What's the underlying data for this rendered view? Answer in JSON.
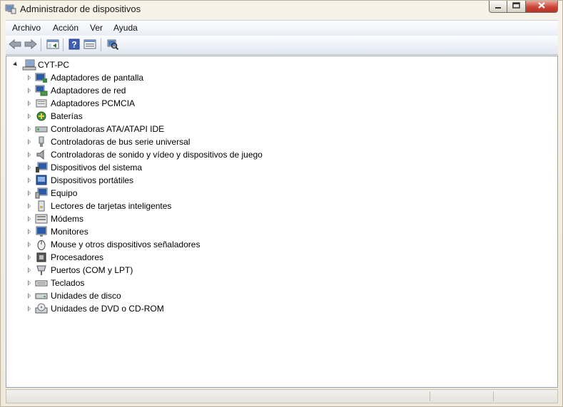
{
  "window": {
    "title": "Administrador de dispositivos",
    "icon": "device-manager-icon",
    "controls": [
      "minimize-icon",
      "maximize-icon",
      "close-icon"
    ]
  },
  "menu": {
    "items": [
      "Archivo",
      "Acción",
      "Ver",
      "Ayuda"
    ]
  },
  "toolbar": {
    "icons": [
      "back-arrow-icon",
      "forward-arrow-icon",
      "show-hide-tree-icon",
      "help-icon",
      "properties-icon",
      "scan-hardware-icon"
    ]
  },
  "tree": {
    "root": {
      "label": "CYT-PC",
      "expanded": true,
      "icon": "computer-icon"
    },
    "items": [
      {
        "label": "Adaptadores de pantalla",
        "icon": "display-adapter-icon"
      },
      {
        "label": "Adaptadores de red",
        "icon": "network-adapter-icon"
      },
      {
        "label": "Adaptadores PCMCIA",
        "icon": "pcmcia-icon"
      },
      {
        "label": "Baterías",
        "icon": "battery-icon"
      },
      {
        "label": "Controladoras ATA/ATAPI IDE",
        "icon": "ide-controller-icon"
      },
      {
        "label": "Controladoras de bus serie universal",
        "icon": "usb-icon"
      },
      {
        "label": "Controladoras de sonido y vídeo y dispositivos de juego",
        "icon": "speaker-icon"
      },
      {
        "label": "Dispositivos del sistema",
        "icon": "system-device-icon"
      },
      {
        "label": "Dispositivos portátiles",
        "icon": "portable-device-icon"
      },
      {
        "label": "Equipo",
        "icon": "computer-small-icon"
      },
      {
        "label": "Lectores de tarjetas inteligentes",
        "icon": "smart-card-icon"
      },
      {
        "label": "Módems",
        "icon": "modem-icon"
      },
      {
        "label": "Monitores",
        "icon": "monitor-icon"
      },
      {
        "label": "Mouse y otros dispositivos señaladores",
        "icon": "mouse-icon"
      },
      {
        "label": "Procesadores",
        "icon": "processor-icon"
      },
      {
        "label": "Puertos (COM y LPT)",
        "icon": "port-icon"
      },
      {
        "label": "Teclados",
        "icon": "keyboard-icon"
      },
      {
        "label": "Unidades de disco",
        "icon": "disk-drive-icon"
      },
      {
        "label": "Unidades de DVD o CD-ROM",
        "icon": "dvd-drive-icon"
      }
    ]
  },
  "colors": {
    "window_bg": "#f4f0e6",
    "tree_bg": "#ffffff",
    "close_button": "#c9463a"
  }
}
